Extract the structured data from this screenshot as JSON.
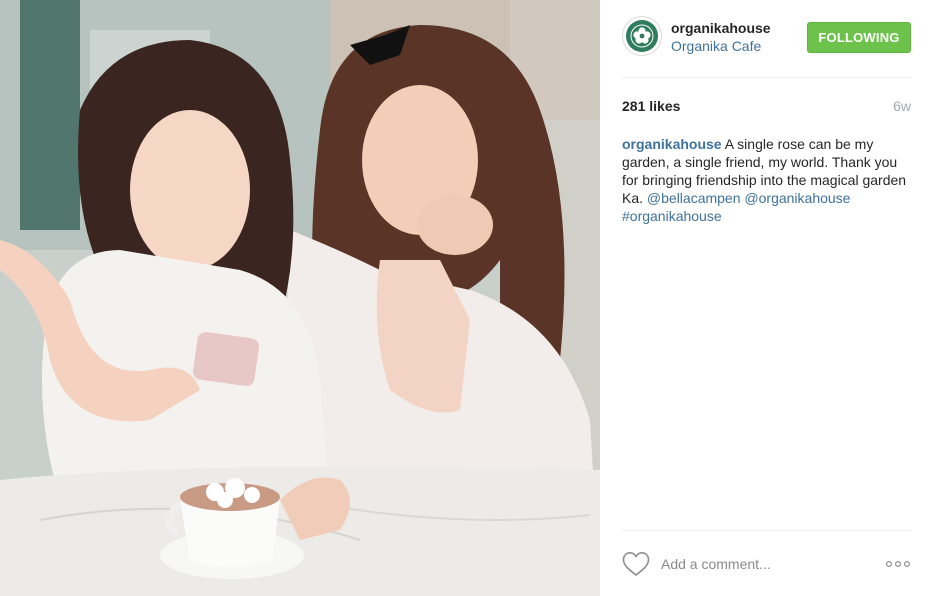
{
  "post": {
    "image_alt": "",
    "header": {
      "username": "organikahouse",
      "location": "Organika Cafe",
      "follow_label": "FOLLOWING",
      "avatar_icon": "flower-logo-icon"
    },
    "likes": "281 likes",
    "time_ago": "6w",
    "caption": {
      "username": "organikahouse",
      "text": " A single rose can be my garden, a single friend, my world. Thank you for bringing friendship into the magical garden Ka. ",
      "mention_1": "@bellacampen",
      "mention_2": "@organikahouse",
      "hashtag": "#organikahouse"
    },
    "footer": {
      "like_icon": "heart-icon",
      "comment_placeholder": "Add a comment...",
      "more_icon": "more-options-icon"
    }
  },
  "colors": {
    "accent_green": "#6cc24a",
    "link_blue": "#3f729b",
    "brand_green": "#2f7d5e"
  }
}
